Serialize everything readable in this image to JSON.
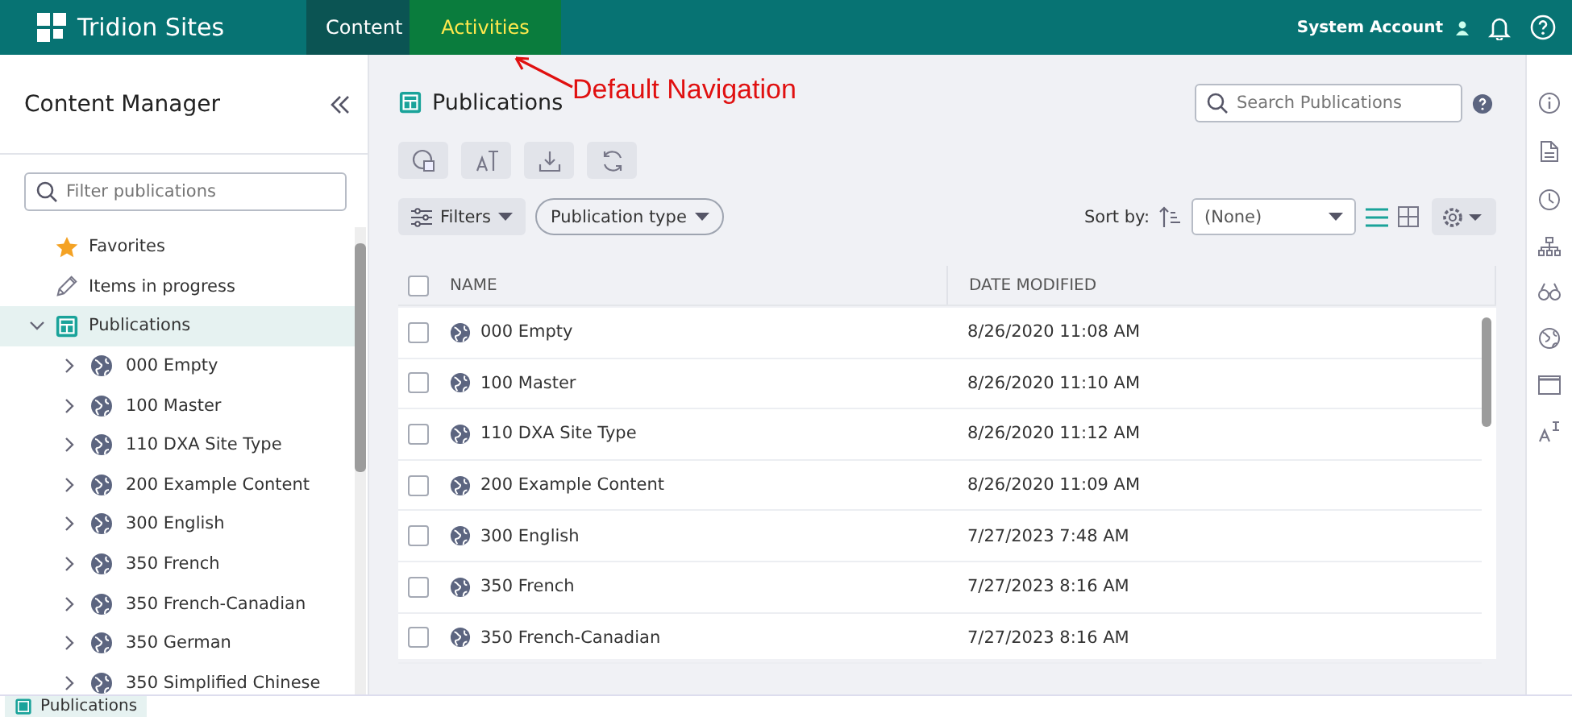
{
  "header": {
    "brand": "Tridion Sites",
    "tabs": [
      {
        "label": "Content",
        "selected": false
      },
      {
        "label": "Activities",
        "selected": true
      }
    ],
    "account": "System Account"
  },
  "annotation": {
    "text": "Default Navigation"
  },
  "sidebar": {
    "title": "Content Manager",
    "filter": {
      "placeholder": "Filter publications"
    },
    "tree": [
      {
        "kind": "favorites",
        "label": "Favorites",
        "selected": false
      },
      {
        "kind": "progress",
        "label": "Items in progress",
        "selected": false
      },
      {
        "kind": "root",
        "label": "Publications",
        "selected": true,
        "expanded": true,
        "children": [
          {
            "label": "000 Empty",
            "expanded": false
          },
          {
            "label": "100 Master",
            "expanded": false
          },
          {
            "label": "110 DXA Site Type",
            "expanded": false
          },
          {
            "label": "200 Example Content",
            "expanded": false
          },
          {
            "label": "300 English",
            "expanded": false
          },
          {
            "label": "350 French",
            "expanded": false
          },
          {
            "label": "350 French-Canadian",
            "expanded": false
          },
          {
            "label": "350 German",
            "expanded": false
          },
          {
            "label": "350 Simplified Chinese",
            "expanded": false
          }
        ]
      }
    ]
  },
  "main": {
    "title": "Publications",
    "search": {
      "placeholder": "Search Publications"
    },
    "filters": [
      "Filters",
      "Publication type"
    ],
    "sort": {
      "label": "Sort by:",
      "value": "(None)"
    },
    "table": {
      "select_all_checked": false,
      "columns": [
        "NAME",
        "DATE MODIFIED"
      ],
      "rows": [
        {
          "name": "000 Empty",
          "date": "8/26/2020 11:08 AM",
          "checked": false
        },
        {
          "name": "100 Master",
          "date": "8/26/2020 11:10 AM",
          "checked": false
        },
        {
          "name": "110 DXA Site Type",
          "date": "8/26/2020 11:12 AM",
          "checked": false
        },
        {
          "name": "200 Example Content",
          "date": "8/26/2020 11:09 AM",
          "checked": false
        },
        {
          "name": "300 English",
          "date": "7/27/2023 7:48 AM",
          "checked": false
        },
        {
          "name": "350 French",
          "date": "7/27/2023 8:16 AM",
          "checked": false
        },
        {
          "name": "350 French-Canadian",
          "date": "7/27/2023 8:16 AM",
          "checked": false
        }
      ]
    }
  },
  "bottom_bar": {
    "tabs": [
      {
        "label": "Publications"
      }
    ]
  }
}
